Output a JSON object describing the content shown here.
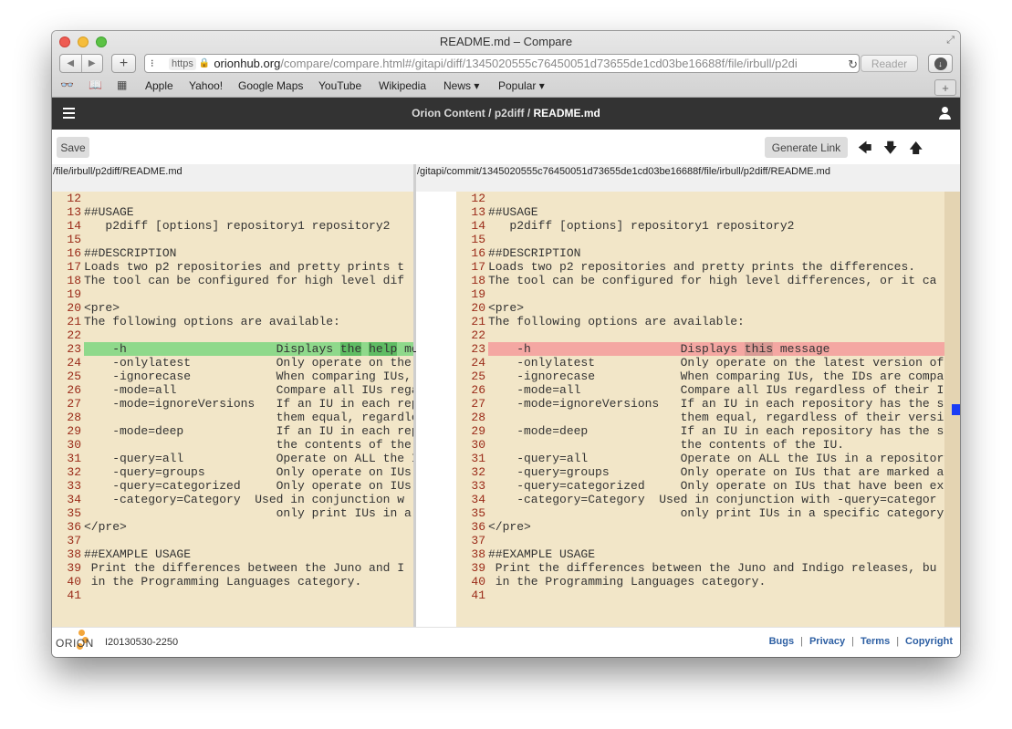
{
  "window": {
    "title": "README.md – Compare"
  },
  "url": {
    "scheme": "https",
    "host": "orionhub.org",
    "path": "/compare/compare.html#/gitapi/diff/1345020555c76450051d73655de1cd03be16688f/file/irbull/p2di"
  },
  "reader_label": "Reader",
  "bookmarks": [
    "Apple",
    "Yahoo!",
    "Google Maps",
    "YouTube",
    "Wikipedia",
    "News ▾",
    "Popular ▾"
  ],
  "banner": {
    "crumb1": "Orion Content",
    "crumb2": "p2diff",
    "current": "README.md"
  },
  "toolbar": {
    "save_label": "Save",
    "generate_link_label": "Generate Link"
  },
  "left": {
    "path": "/file/irbull/p2diff/README.md",
    "line_numbers": [
      "12",
      "13",
      "14",
      "15",
      "16",
      "17",
      "18",
      "19",
      "20",
      "21",
      "22",
      "23",
      "24",
      "25",
      "26",
      "27",
      "28",
      "29",
      "30",
      "31",
      "32",
      "33",
      "34",
      "35",
      "36",
      "37",
      "38",
      "39",
      "40",
      "41"
    ],
    "lines": [
      "",
      "##USAGE",
      "   p2diff [options] repository1 repository2",
      "",
      "##DESCRIPTION",
      "Loads two p2 repositories and pretty prints t",
      "The tool can be configured for high level dif",
      "",
      "<pre>",
      "The following options are available:",
      "",
      "    -h                     Displays the help me",
      "    -onlylatest            Only operate on the",
      "    -ignorecase            When comparing IUs,",
      "    -mode=all              Compare all IUs rega",
      "    -mode=ignoreVersions   If an IU in each rep",
      "                           them equal, regardle",
      "    -mode=deep             If an IU in each rep",
      "                           the contents of the",
      "    -query=all             Operate on ALL the I",
      "    -query=groups          Only operate on IUs",
      "    -query=categorized     Only operate on IUs",
      "    -category=Category  Used in conjunction w",
      "                           only print IUs in a",
      "</pre>",
      "",
      "##EXAMPLE USAGE",
      " Print the differences between the Juno and I",
      " in the Programming Languages category.",
      ""
    ]
  },
  "right": {
    "path": "/gitapi/commit/1345020555c76450051d73655de1cd03be16688f/file/irbull/p2diff/README.md",
    "line_numbers": [
      "12",
      "13",
      "14",
      "15",
      "16",
      "17",
      "18",
      "19",
      "20",
      "21",
      "22",
      "23",
      "24",
      "25",
      "26",
      "27",
      "28",
      "29",
      "30",
      "31",
      "32",
      "33",
      "34",
      "35",
      "36",
      "37",
      "38",
      "39",
      "40",
      "41"
    ],
    "lines": [
      "",
      "##USAGE",
      "   p2diff [options] repository1 repository2",
      "",
      "##DESCRIPTION",
      "Loads two p2 repositories and pretty prints the differences.",
      "The tool can be configured for high level differences, or it ca",
      "",
      "<pre>",
      "The following options are available:",
      "",
      "    -h                     Displays this message",
      "    -onlylatest            Only operate on the latest version of",
      "    -ignorecase            When comparing IUs, the IDs are compar",
      "    -mode=all              Compare all IUs regardless of their ID",
      "    -mode=ignoreVersions   If an IU in each repository has the sa",
      "                           them equal, regardless of their versio",
      "    -mode=deep             If an IU in each repository has the sa",
      "                           the contents of the IU.",
      "    -query=all             Operate on ALL the IUs in a repository",
      "    -query=groups          Only operate on IUs that are marked as",
      "    -query=categorized     Only operate on IUs that have been exp",
      "    -category=Category  Used in conjunction with -query=categor",
      "                           only print IUs in a specific category",
      "</pre>",
      "",
      "##EXAMPLE USAGE",
      " Print the differences between the Juno and Indigo releases, bu",
      " in the Programming Languages category.",
      ""
    ]
  },
  "changed": {
    "left": {
      "before": "    -h                     Displays ",
      "w1": "the",
      "mid": " ",
      "w2": "help",
      "after": " me"
    },
    "right": {
      "before": "    -h                     Displays ",
      "w1": "this",
      "after": " message"
    }
  },
  "footer": {
    "logo": "ORION",
    "build": "I20130530-2250",
    "links": [
      "Bugs",
      "Privacy",
      "Terms",
      "Copyright"
    ]
  },
  "colors": {
    "editor_background": "#f2e6c8",
    "added_line": "#8fd98b",
    "removed_line": "#f4a7a2",
    "banner": "#333333",
    "overview_marker": "#1a3cf5",
    "link": "#2d5fa3"
  }
}
